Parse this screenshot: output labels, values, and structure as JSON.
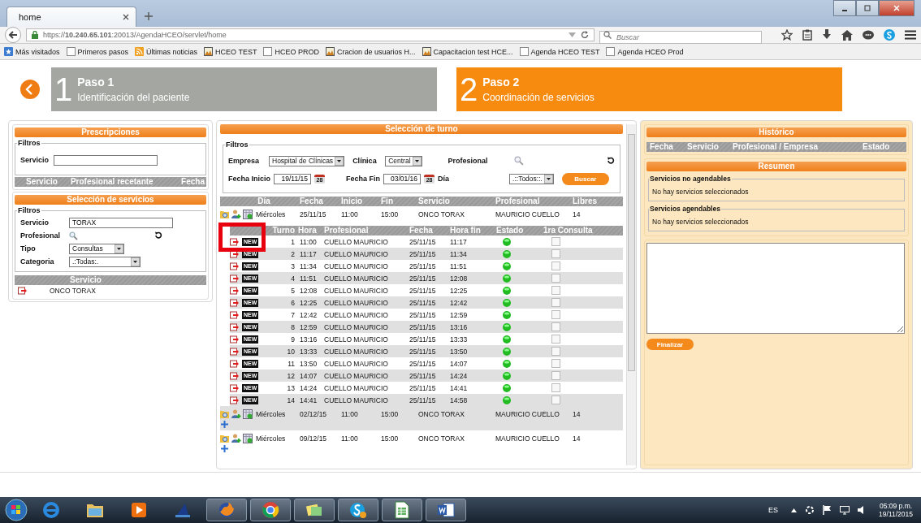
{
  "browser": {
    "tab_title": "home",
    "url": "https://**10.240.65.101**:20013/AgendaHCEO/servlet/home",
    "search_placeholder": "Buscar",
    "bookmarks": [
      {
        "label": "Más visitados"
      },
      {
        "label": "Primeros pasos"
      },
      {
        "label": "Últimas noticias"
      },
      {
        "label": "HCEO TEST"
      },
      {
        "label": "HCEO PROD"
      },
      {
        "label": "Cracion de usuarios H..."
      },
      {
        "label": "Capacitacion test HCE..."
      },
      {
        "label": "Agenda HCEO TEST"
      },
      {
        "label": "Agenda HCEO Prod"
      }
    ]
  },
  "steps": [
    {
      "number": "1",
      "title": "Paso 1",
      "subtitle": "Identificación del paciente",
      "selected": false
    },
    {
      "number": "2",
      "title": "Paso 2",
      "subtitle": "Coordinación de servicios",
      "selected": true
    }
  ],
  "prescripciones": {
    "title": "Prescripciones",
    "filters_legend": "Filtros",
    "servicio_label": "Servicio",
    "columns": [
      "Servicio",
      "Profesional recetante",
      "Fecha"
    ]
  },
  "seleccion_servicios": {
    "title": "Selección de servicios",
    "filters_legend": "Filtros",
    "fields": [
      {
        "kind": "text",
        "label": "Servicio",
        "value": "TORAX"
      },
      {
        "kind": "search",
        "label": "Profesional"
      },
      {
        "kind": "select",
        "label": "Tipo",
        "value": "Consultas"
      },
      {
        "kind": "select",
        "label": "Categoria",
        "value": ".:Todas:."
      }
    ],
    "column": "Servicio",
    "items": [
      "ONCO TORAX"
    ]
  },
  "turno": {
    "title": "Selección de turno",
    "filters_legend": "Filtros",
    "empresa": {
      "label": "Empresa",
      "value": "Hospital de Clínicas"
    },
    "clinica": {
      "label": "Clínica",
      "value": "Central"
    },
    "profesional_label": "Profesional",
    "fecha_inicio": {
      "label": "Fecha Inicio",
      "value": "19/11/15",
      "calendar_day": "28"
    },
    "fecha_fin": {
      "label": "Fecha Fin",
      "value": "03/01/16",
      "calendar_day": "28"
    },
    "dia": {
      "label": "Día",
      "value": ".::Todos::."
    },
    "search_button": "Buscar",
    "columns": [
      "Día",
      "Fecha",
      "Inicio",
      "Fin",
      "Servicio",
      "Profesional",
      "Libres"
    ],
    "slot_columns": [
      "Turno",
      "Hora",
      "Profesional",
      "Fecha",
      "Hora fin",
      "Estado",
      "1ra Consulta"
    ],
    "days": [
      {
        "dia": "Miércoles",
        "fecha": "25/11/15",
        "inicio": "11:00",
        "fin": "15:00",
        "servicio": "ONCO TORAX",
        "profesional": "MAURICIO CUELLO",
        "libres": "14",
        "expanded": true,
        "slots": [
          {
            "turno": "1",
            "hora": "11:00",
            "profesional": "CUELLO MAURICIO",
            "fecha": "25/11/15",
            "hora_fin": "11:17",
            "badge": "NEW",
            "primera_consulta": false
          },
          {
            "turno": "2",
            "hora": "11:17",
            "profesional": "CUELLO MAURICIO",
            "fecha": "25/11/15",
            "hora_fin": "11:34",
            "badge": "NEW",
            "primera_consulta": false
          },
          {
            "turno": "3",
            "hora": "11:34",
            "profesional": "CUELLO MAURICIO",
            "fecha": "25/11/15",
            "hora_fin": "11:51",
            "badge": "NEW",
            "primera_consulta": false
          },
          {
            "turno": "4",
            "hora": "11:51",
            "profesional": "CUELLO MAURICIO",
            "fecha": "25/11/15",
            "hora_fin": "12:08",
            "badge": "NEW",
            "primera_consulta": false
          },
          {
            "turno": "5",
            "hora": "12:08",
            "profesional": "CUELLO MAURICIO",
            "fecha": "25/11/15",
            "hora_fin": "12:25",
            "badge": "NEW",
            "primera_consulta": false
          },
          {
            "turno": "6",
            "hora": "12:25",
            "profesional": "CUELLO MAURICIO",
            "fecha": "25/11/15",
            "hora_fin": "12:42",
            "badge": "NEW",
            "primera_consulta": false
          },
          {
            "turno": "7",
            "hora": "12:42",
            "profesional": "CUELLO MAURICIO",
            "fecha": "25/11/15",
            "hora_fin": "12:59",
            "badge": "NEW",
            "primera_consulta": false
          },
          {
            "turno": "8",
            "hora": "12:59",
            "profesional": "CUELLO MAURICIO",
            "fecha": "25/11/15",
            "hora_fin": "13:16",
            "badge": "NEW",
            "primera_consulta": false
          },
          {
            "turno": "9",
            "hora": "13:16",
            "profesional": "CUELLO MAURICIO",
            "fecha": "25/11/15",
            "hora_fin": "13:33",
            "badge": "NEW",
            "primera_consulta": false
          },
          {
            "turno": "10",
            "hora": "13:33",
            "profesional": "CUELLO MAURICIO",
            "fecha": "25/11/15",
            "hora_fin": "13:50",
            "badge": "NEW",
            "primera_consulta": false
          },
          {
            "turno": "11",
            "hora": "13:50",
            "profesional": "CUELLO MAURICIO",
            "fecha": "25/11/15",
            "hora_fin": "14:07",
            "badge": "NEW",
            "primera_consulta": false
          },
          {
            "turno": "12",
            "hora": "14:07",
            "profesional": "CUELLO MAURICIO",
            "fecha": "25/11/15",
            "hora_fin": "14:24",
            "badge": "NEW",
            "primera_consulta": false
          },
          {
            "turno": "13",
            "hora": "14:24",
            "profesional": "CUELLO MAURICIO",
            "fecha": "25/11/15",
            "hora_fin": "14:41",
            "badge": "NEW",
            "primera_consulta": false
          },
          {
            "turno": "14",
            "hora": "14:41",
            "profesional": "CUELLO MAURICIO",
            "fecha": "25/11/15",
            "hora_fin": "14:58",
            "badge": "NEW",
            "primera_consulta": false
          }
        ]
      },
      {
        "dia": "Miércoles",
        "fecha": "02/12/15",
        "inicio": "11:00",
        "fin": "15:00",
        "servicio": "ONCO TORAX",
        "profesional": "MAURICIO CUELLO",
        "libres": "14",
        "expanded": false
      },
      {
        "dia": "Miércoles",
        "fecha": "09/12/15",
        "inicio": "11:00",
        "fin": "15:00",
        "servicio": "ONCO TORAX",
        "profesional": "MAURICIO CUELLO",
        "libres": "14",
        "expanded": false
      }
    ]
  },
  "historico": {
    "title": "Histórico",
    "columns": [
      "Fecha",
      "Servicio",
      "Profesional / Empresa",
      "Estado"
    ]
  },
  "resumen": {
    "title": "Resumen",
    "groups": [
      {
        "legend": "Servicios no agendables",
        "text": "No hay servicios seleccionados"
      },
      {
        "legend": "Servicios agendables",
        "text": "No hay servicios seleccionados"
      }
    ]
  },
  "finalizar_button": "Finalizar",
  "taskbar": {
    "language": "ES",
    "time": "05:09 p.m.",
    "date": "19/11/2015"
  }
}
